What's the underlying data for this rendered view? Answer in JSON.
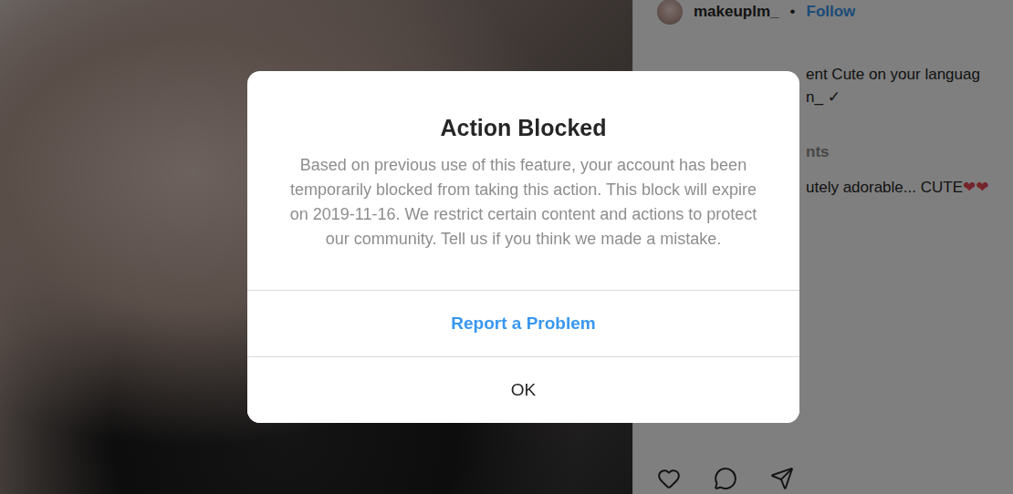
{
  "post": {
    "username": "makeuplm_",
    "separator": "•",
    "follow": "Follow",
    "caption_lines": [
      "ent Cute on your languag",
      "n_ ✓"
    ],
    "comments_heading": "nts",
    "comments": [
      {
        "text": "utely adorable... CUTE",
        "hearts": "❤❤"
      }
    ]
  },
  "dialog": {
    "title": "Action Blocked",
    "message": "Based on previous use of this feature, your account has been temporarily blocked from taking this action. This block will expire on 2019-11-16. We restrict certain content and actions to protect our community. Tell us if you think we made a mistake.",
    "buttons": [
      {
        "label": "Report a Problem",
        "kind": "primary"
      },
      {
        "label": "OK",
        "kind": "plain"
      }
    ]
  }
}
